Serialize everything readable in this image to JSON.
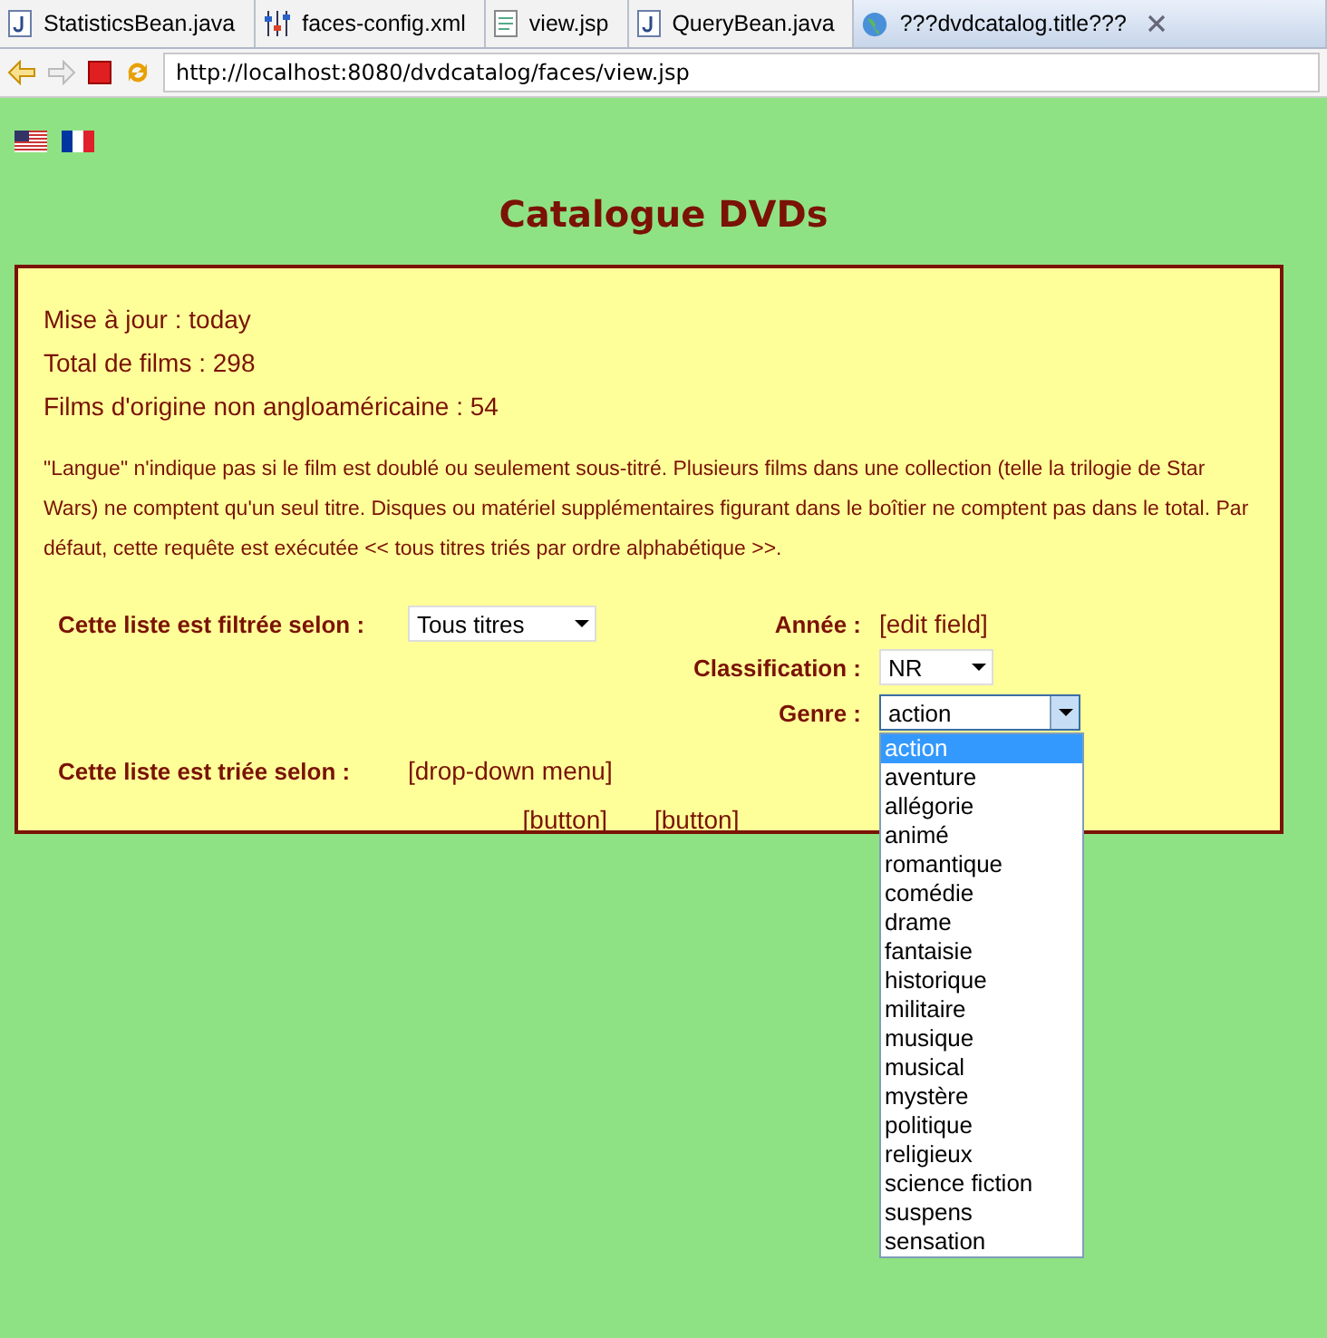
{
  "tabs": [
    {
      "label": "StatisticsBean.java",
      "kind": "java",
      "selected": false,
      "closable": false
    },
    {
      "label": "faces-config.xml",
      "kind": "config",
      "selected": false,
      "closable": false
    },
    {
      "label": "view.jsp",
      "kind": "jsp",
      "selected": false,
      "closable": false
    },
    {
      "label": "QueryBean.java",
      "kind": "java",
      "selected": false,
      "closable": false
    },
    {
      "label": "???dvdcatalog.title???",
      "kind": "web",
      "selected": true,
      "closable": true
    }
  ],
  "toolbar": {
    "back_disabled": false,
    "forward_disabled": true,
    "url": "http://localhost:8080/dvdcatalog/faces/view.jsp"
  },
  "page": {
    "title": "Catalogue DVDs",
    "stats": [
      "Mise à jour : today",
      "Total de films : 298",
      "Films d'origine non angloaméricaine : 54"
    ],
    "note": "\"Langue\" n'indique pas si le film est doublé ou seulement sous-titré.  Plusieurs films dans une collection (telle la trilogie de Star Wars) ne comptent qu'un seul titre. Disques ou matériel supplémentaires figurant dans le boîtier ne comptent pas dans le total.  Par défaut, cette requête est exécutée << tous titres triés par ordre alphabétique >>.",
    "filter": {
      "label": "Cette liste est filtrée selon :",
      "value": "Tous titres"
    },
    "year": {
      "label": "Année :",
      "value": "[edit field]"
    },
    "classification": {
      "label": "Classification :",
      "value": "NR"
    },
    "genre": {
      "label": "Genre :",
      "value": "action",
      "expanded": true,
      "options": [
        {
          "label": "action",
          "selected": true
        },
        {
          "label": "aventure",
          "selected": false
        },
        {
          "label": "allégorie",
          "selected": false
        },
        {
          "label": "animé",
          "selected": false
        },
        {
          "label": "romantique",
          "selected": false
        },
        {
          "label": "comédie",
          "selected": false
        },
        {
          "label": "drame",
          "selected": false
        },
        {
          "label": "fantaisie",
          "selected": false
        },
        {
          "label": "historique",
          "selected": false
        },
        {
          "label": "militaire",
          "selected": false
        },
        {
          "label": "musique",
          "selected": false
        },
        {
          "label": "musical",
          "selected": false
        },
        {
          "label": "mystère",
          "selected": false
        },
        {
          "label": "politique",
          "selected": false
        },
        {
          "label": "religieux",
          "selected": false
        },
        {
          "label": "science fiction",
          "selected": false
        },
        {
          "label": "suspens",
          "selected": false
        },
        {
          "label": "sensation",
          "selected": false
        }
      ]
    },
    "sort": {
      "label": "Cette liste est triée selon :",
      "value": "[drop-down menu]"
    },
    "buttons": [
      "[button]",
      "[button]"
    ]
  }
}
